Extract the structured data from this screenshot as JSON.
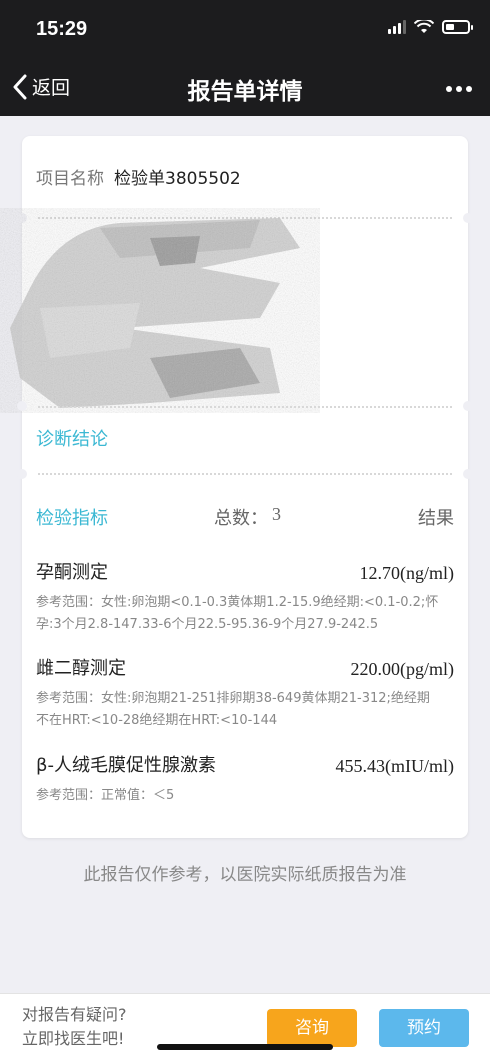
{
  "status_bar": {
    "time": "15:29",
    "icons": [
      "signal-icon",
      "wifi-icon",
      "battery-icon"
    ]
  },
  "nav": {
    "back_label": "返回",
    "title": "报告单详情",
    "more_icon": "more-icon"
  },
  "card": {
    "project_label": "项目名称",
    "project_value": "检验单3805502",
    "diagnosis_title": "诊断结论",
    "indicators_title": "检验指标",
    "total_label": "总数：",
    "total_value": "3",
    "result_label": "结果",
    "indicators": [
      {
        "name": "孕酮测定",
        "value": "12.70(ng/ml)",
        "range_line1": "参考范围：女性:卵泡期<0.1-0.3黄体期1.2-15.9绝经期:<0.1-0.2;怀",
        "range_line2": "孕:3个月2.8-147.33-6个月22.5-95.36-9个月27.9-242.5"
      },
      {
        "name": "雌二醇测定",
        "value": "220.00(pg/ml)",
        "range_line1": "参考范围：女性:卵泡期21-251排卵期38-649黄体期21-312;绝经期",
        "range_line2": "不在HRT:<10-28绝经期在HRT:<10-144"
      },
      {
        "name": "β-人绒毛膜促性腺激素",
        "value": "455.43(mIU/ml)",
        "range_line1": "参考范围：正常值：＜5",
        "range_line2": ""
      }
    ]
  },
  "disclaimer": "此报告仅作参考，以医院实际纸质报告为准",
  "bottom_bar": {
    "question_line1": "对报告有疑问?",
    "question_line2": "立即找医生吧!",
    "consult_label": "咨询",
    "book_label": "预约"
  },
  "colors": {
    "accent": "#3bb8d3",
    "consult": "#f7a51c",
    "book": "#5cb8ec",
    "nav_bg": "#1c1c1e",
    "page_bg": "#efeff4"
  }
}
